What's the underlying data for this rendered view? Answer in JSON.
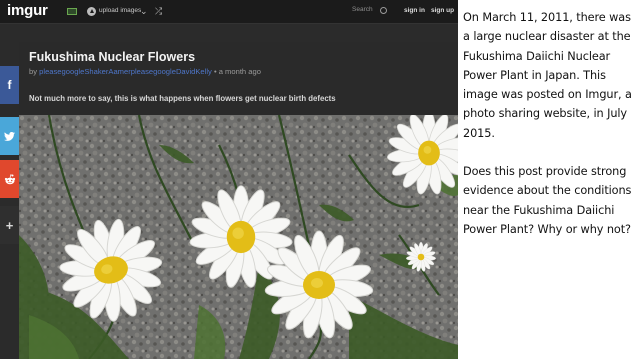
{
  "navbar": {
    "logo": "imgur",
    "upload_label": "upload images",
    "dropdown_icon": "chevron-down-icon",
    "random_icon": "shuffle-icon",
    "search_placeholder": "Search",
    "signin_label": "sign in",
    "signup_label": "sign up"
  },
  "post": {
    "title": "Fukushima Nuclear Flowers",
    "by_prefix": "by",
    "author": "pleasegoogleShakerAamerpleasegoogleDavidKelly",
    "time": "• a month ago",
    "description": "Not much more to say, this is what happens when flowers get nuclear birth defects"
  },
  "share": {
    "facebook": "f",
    "twitter": "twitter-bird-icon",
    "reddit": "reddit-alien-icon",
    "more": "+"
  },
  "caption": {
    "paragraph1": "On March 11, 2011, there was a large nuclear disaster at the Fukushima Daiichi Nuclear Power Plant in Japan. This image was posted on Imgur, a photo sharing website, in July 2015.",
    "paragraph2": "Does this post provide strong evidence about the conditions near the Fukushima Daiichi Power Plant? Why or why not?"
  },
  "colors": {
    "imgur_bg": "#2a2a2a",
    "author_link": "#4e76c9",
    "facebook": "#3b5998",
    "twitter": "#4aa7d9",
    "reddit": "#e0482d",
    "daisy_center": "#e8c31a"
  }
}
